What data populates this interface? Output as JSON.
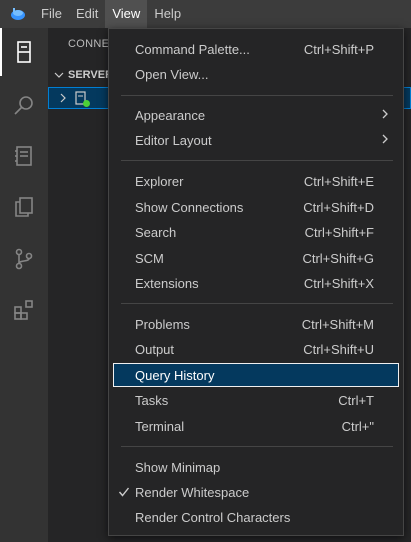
{
  "menubar": {
    "items": [
      "File",
      "Edit",
      "View",
      "Help"
    ],
    "active": "View"
  },
  "sidebar": {
    "title": "CONNEC",
    "section": "SERVER"
  },
  "view_menu": {
    "groups": [
      [
        {
          "label": "Command Palette...",
          "shortcut": "Ctrl+Shift+P"
        },
        {
          "label": "Open View...",
          "shortcut": ""
        }
      ],
      [
        {
          "label": "Appearance",
          "shortcut": "",
          "submenu": true
        },
        {
          "label": "Editor Layout",
          "shortcut": "",
          "submenu": true
        }
      ],
      [
        {
          "label": "Explorer",
          "shortcut": "Ctrl+Shift+E"
        },
        {
          "label": "Show Connections",
          "shortcut": "Ctrl+Shift+D"
        },
        {
          "label": "Search",
          "shortcut": "Ctrl+Shift+F"
        },
        {
          "label": "SCM",
          "shortcut": "Ctrl+Shift+G"
        },
        {
          "label": "Extensions",
          "shortcut": "Ctrl+Shift+X"
        }
      ],
      [
        {
          "label": "Problems",
          "shortcut": "Ctrl+Shift+M"
        },
        {
          "label": "Output",
          "shortcut": "Ctrl+Shift+U"
        },
        {
          "label": "Query History",
          "shortcut": "",
          "highlighted": true
        },
        {
          "label": "Tasks",
          "shortcut": "Ctrl+T"
        },
        {
          "label": "Terminal",
          "shortcut": "Ctrl+\""
        }
      ],
      [
        {
          "label": "Show Minimap",
          "shortcut": ""
        },
        {
          "label": "Render Whitespace",
          "shortcut": "",
          "checked": true
        },
        {
          "label": "Render Control Characters",
          "shortcut": ""
        }
      ]
    ]
  },
  "colors": {
    "accent": "#007fd4",
    "highlight_bg": "#04395e",
    "status_online": "#4cd137"
  }
}
